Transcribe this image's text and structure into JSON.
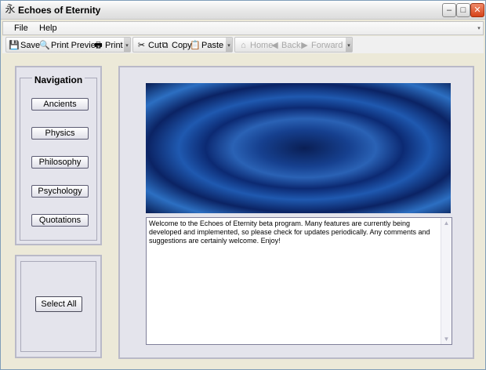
{
  "window": {
    "title": "Echoes of Eternity",
    "app_icon_glyph": "永",
    "controls": {
      "minimize": "–",
      "maximize": "□",
      "close": "✕"
    }
  },
  "menu": {
    "items": [
      {
        "label": "File"
      },
      {
        "label": "Help"
      }
    ],
    "overflow_glyph": "▾"
  },
  "toolbar": {
    "groups": [
      {
        "buttons": [
          {
            "label": "Save",
            "icon": "save-icon",
            "glyph": "💾",
            "enabled": true
          },
          {
            "label": "Print Preview",
            "icon": "print-preview-icon",
            "glyph": "🔍",
            "enabled": true
          },
          {
            "label": "Print",
            "icon": "print-icon",
            "glyph": "🖶",
            "enabled": true
          }
        ]
      },
      {
        "buttons": [
          {
            "label": "Cut",
            "icon": "cut-icon",
            "glyph": "✂",
            "enabled": true
          },
          {
            "label": "Copy",
            "icon": "copy-icon",
            "glyph": "⧉",
            "enabled": true
          },
          {
            "label": "Paste",
            "icon": "paste-icon",
            "glyph": "📋",
            "enabled": true
          }
        ]
      },
      {
        "buttons": [
          {
            "label": "Home",
            "icon": "home-icon",
            "glyph": "⌂",
            "enabled": false
          },
          {
            "label": "Back",
            "icon": "back-icon",
            "glyph": "◀",
            "enabled": false
          },
          {
            "label": "Forward",
            "icon": "forward-icon",
            "glyph": "▶",
            "enabled": false
          }
        ]
      }
    ],
    "grip_glyph": "▾"
  },
  "navigation": {
    "title": "Navigation",
    "buttons": [
      "Ancients",
      "Physics",
      "Philosophy",
      "Psychology",
      "Quotations"
    ]
  },
  "select_all": {
    "label": "Select All"
  },
  "content": {
    "text": "Welcome to the Echoes of Eternity beta program.  Many features are currently being developed and implemented, so please check for updates periodically.  Any comments and suggestions are certainly welcome.  Enjoy!",
    "scroll_up_glyph": "▲",
    "scroll_down_glyph": "▼"
  },
  "colors": {
    "accent_blue": "#1f59b0",
    "panel_bg": "#e4e4ec",
    "close_red": "#d6431a"
  }
}
